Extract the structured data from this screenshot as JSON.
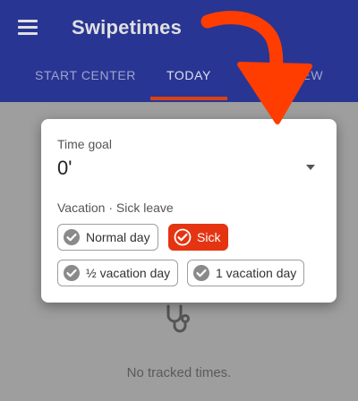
{
  "app": {
    "title": "Swipetimes"
  },
  "tabs": [
    {
      "label": "START CENTER"
    },
    {
      "label": "TODAY"
    },
    {
      "label": "VIEW"
    }
  ],
  "empty_state": {
    "text": "No tracked times."
  },
  "dialog": {
    "time_goal_label": "Time goal",
    "time_goal_value": "0'",
    "section_label": "Vacation · Sick leave",
    "options": [
      {
        "label": "Normal day",
        "selected": false
      },
      {
        "label": "Sick",
        "selected": true
      },
      {
        "label": "½ vacation day",
        "selected": false
      },
      {
        "label": "1 vacation day",
        "selected": false
      }
    ]
  },
  "colors": {
    "appbar": "#283593",
    "accent": "#e53412",
    "annotation_arrow": "#ff3d00",
    "overlay_background": "#9e9e9e"
  }
}
